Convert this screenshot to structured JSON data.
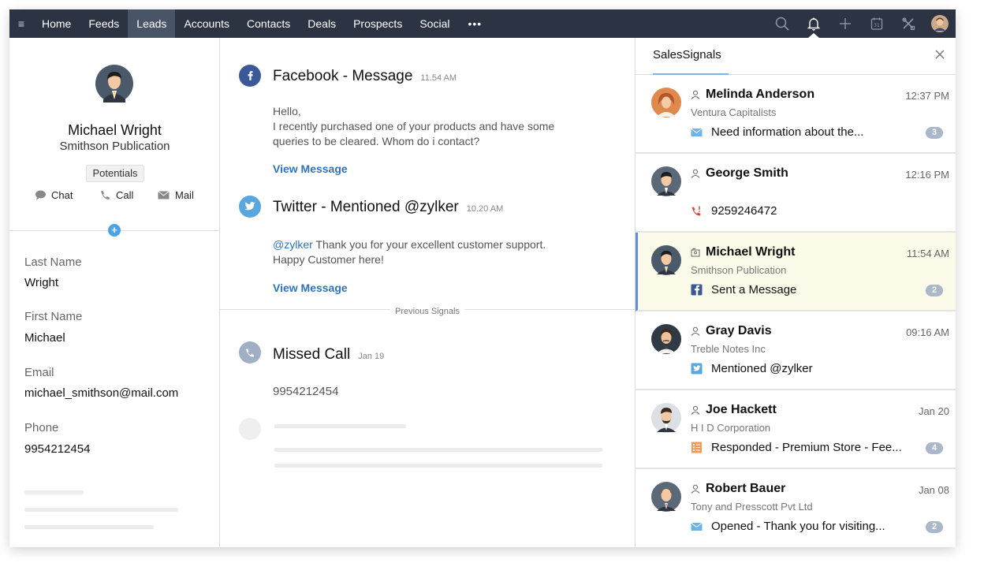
{
  "nav": {
    "tabs": [
      "Home",
      "Feeds",
      "Leads",
      "Accounts",
      "Contacts",
      "Deals",
      "Prospects",
      "Social"
    ],
    "active_tab": "Leads",
    "more": "•••"
  },
  "lead": {
    "name": "Michael Wright",
    "company": "Smithson Publication",
    "badge": "Potentials",
    "actions": {
      "chat": "Chat",
      "call": "Call",
      "mail": "Mail"
    },
    "add": "+",
    "fields": [
      {
        "label": "Last Name",
        "value": "Wright"
      },
      {
        "label": "First Name",
        "value": "Michael"
      },
      {
        "label": "Email",
        "value": "michael_smithson@mail.com"
      },
      {
        "label": "Phone",
        "value": "9954212454"
      }
    ]
  },
  "signals": {
    "facebook": {
      "title": "Facebook - Message",
      "time": "11.54 AM",
      "greeting": "Hello,",
      "body": "I recently purchased one of your products and have some queries to be cleared. Whom do i contact?",
      "link": "View Message"
    },
    "twitter": {
      "title": "Twitter - Mentioned @zylker",
      "time": "10.20 AM",
      "handle": "@zylker",
      "body": " Thank you for your excellent customer support. Happy Customer here!",
      "link": "View Message"
    },
    "previous_label": "Previous Signals",
    "missed_call": {
      "title": "Missed Call",
      "time": "Jan 19",
      "number": "9954212454"
    }
  },
  "sales_signals": {
    "title": "SalesSignals",
    "items": [
      {
        "name": "Melinda Anderson",
        "company": "Ventura Capitalists",
        "time": "12:37 PM",
        "message": "Need information about the...",
        "channel": "mail-icon",
        "count": "3"
      },
      {
        "name": "George Smith",
        "company": "",
        "time": "12:16 PM",
        "message": "9259246472",
        "channel": "missed-call-icon",
        "count": ""
      },
      {
        "name": "Michael Wright",
        "company": "Smithson Publication",
        "time": "11:54 AM",
        "message": "Sent a Message",
        "channel": "facebook-icon",
        "count": "2"
      },
      {
        "name": "Gray Davis",
        "company": "Treble Notes Inc",
        "time": "09:16 AM",
        "message": "Mentioned @zylker",
        "channel": "twitter-icon",
        "count": ""
      },
      {
        "name": "Joe Hackett",
        "company": "H I D Corporation",
        "time": "Jan 20",
        "message": "Responded - Premium Store - Fee...",
        "channel": "survey-icon",
        "count": "4"
      },
      {
        "name": "Robert Bauer",
        "company": "Tony and Presscott Pvt Ltd",
        "time": "Jan 08",
        "message": "Opened - Thank you for visiting...",
        "channel": "mail-icon",
        "count": "2"
      }
    ]
  },
  "colors": {
    "nav_bg": "#2c3444",
    "active_tab_bg": "#4a5467",
    "link": "#2d72c4",
    "selected_card_bg": "#fcfbea",
    "selected_card_border": "#5c8ee6",
    "badge_count": "#a9b7c9"
  }
}
